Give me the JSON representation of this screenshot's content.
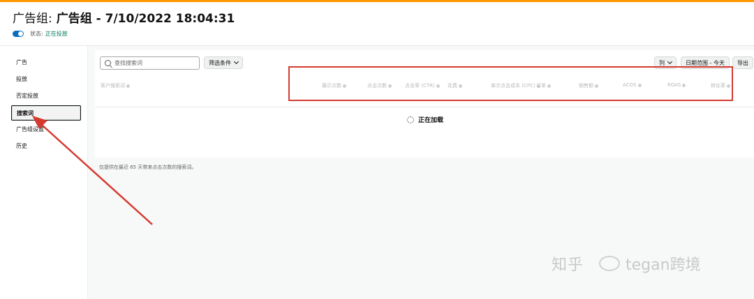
{
  "header": {
    "title_prefix": "广告组:",
    "title_main": "广告组 - 7/10/2022 18:04:31",
    "status_label": "状态:",
    "status_value": "正在投放"
  },
  "sidebar": {
    "items": [
      {
        "label": "广告"
      },
      {
        "label": "投放"
      },
      {
        "label": "否定投放"
      },
      {
        "label": "搜索词"
      },
      {
        "label": "广告组设置"
      },
      {
        "label": "历史"
      }
    ],
    "active_index": 3
  },
  "toolbar": {
    "search_placeholder": "查找搜索词",
    "filter_label": "筛选条件",
    "columns_label": "列",
    "date_range_label": "日期范围 - 今天",
    "export_label": "导出"
  },
  "table": {
    "columns": [
      "客户搜索词",
      "展示次数",
      "点击次数",
      "点击率 (CTR)",
      "花费",
      "单次点击成本 (CPC)",
      "订单",
      "销售额",
      "ACOS",
      "ROAS",
      "转化率"
    ]
  },
  "loading_text": "正在加载",
  "footnote": "仅提供在最近 65 天带来点击次数的搜索词。",
  "watermark": {
    "zhihu": "知乎",
    "name": "tegan跨境"
  },
  "colors": {
    "accent_top": "#ff9900",
    "highlight": "#d43a2f",
    "status_green": "#067d62",
    "toggle_blue": "#0a6ebd"
  }
}
